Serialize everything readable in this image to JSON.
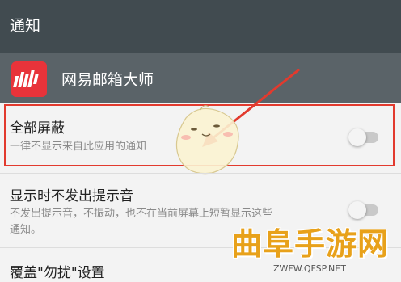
{
  "header": {
    "title": "通知"
  },
  "app": {
    "name": "网易邮箱大师",
    "icon": "netease-mail-master-icon",
    "icon_color": "#e8333a"
  },
  "settings": [
    {
      "label": "全部屏蔽",
      "description": "一律不显示来自此应用的通知",
      "enabled": false,
      "highlighted": true
    },
    {
      "label": "显示时不发出提示音",
      "description_lines": [
        "不发出提示音，不振动，也不在当前屏幕上短暂显示这些",
        "通知。"
      ],
      "enabled": false
    },
    {
      "label": "覆盖\"勿扰\"设置"
    }
  ],
  "watermark": {
    "text": "曲阜手游网",
    "url": "ZWFW.QFSP.NET"
  },
  "colors": {
    "header_bg": "#414b50",
    "app_bar_bg": "#5a6368",
    "highlight": "#e23a2e",
    "watermark": "#e8a11a"
  }
}
